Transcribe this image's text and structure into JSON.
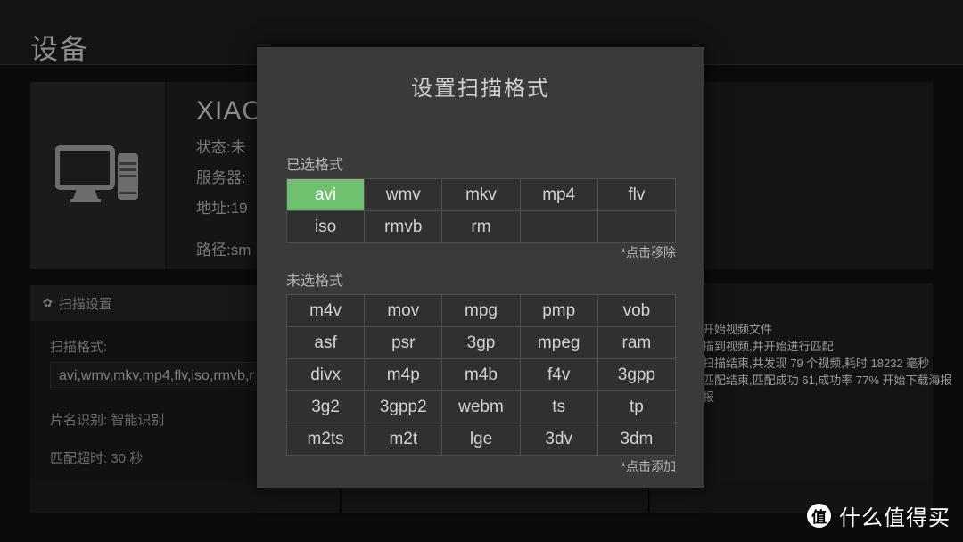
{
  "app": {
    "title": "设备"
  },
  "device": {
    "icon": "desktop-computer-icon",
    "name": "XIAO",
    "lines": [
      "状态:未",
      "服务器:",
      "地址:19",
      "路径:sm"
    ]
  },
  "scan_settings": {
    "gear_icon": "✿",
    "header": "扫描设置",
    "format_label": "扫描格式:",
    "format_value": "avi,wmv,mkv,mp4,flv,iso,rmvb,r",
    "title_recognition": "片名识别: 智能识别",
    "match_timeout": "匹配超时: 30 秒"
  },
  "log": {
    "lines": [
      "开始视频文件",
      "描到视频,并开始进行匹配",
      "扫描结束,共发现 79 个视频,耗时 18232 毫秒",
      "匹配结束,匹配成功 61,成功率 77% 开始下载海报",
      "报"
    ]
  },
  "modal": {
    "title": "设置扫描格式",
    "selected_label": "已选格式",
    "selected_hint": "*点击移除",
    "unselected_label": "未选格式",
    "unselected_hint": "*点击添加",
    "selected_formats": [
      {
        "label": "avi",
        "active": true
      },
      {
        "label": "wmv",
        "active": false
      },
      {
        "label": "mkv",
        "active": false
      },
      {
        "label": "mp4",
        "active": false
      },
      {
        "label": "flv",
        "active": false
      },
      {
        "label": "iso",
        "active": false
      },
      {
        "label": "rmvb",
        "active": false
      },
      {
        "label": "rm",
        "active": false
      },
      {
        "label": "",
        "active": false
      },
      {
        "label": "",
        "active": false
      }
    ],
    "unselected_formats": [
      {
        "label": "m4v"
      },
      {
        "label": "mov"
      },
      {
        "label": "mpg"
      },
      {
        "label": "pmp"
      },
      {
        "label": "vob"
      },
      {
        "label": "asf"
      },
      {
        "label": "psr"
      },
      {
        "label": "3gp"
      },
      {
        "label": "mpeg"
      },
      {
        "label": "ram"
      },
      {
        "label": "divx"
      },
      {
        "label": "m4p"
      },
      {
        "label": "m4b"
      },
      {
        "label": "f4v"
      },
      {
        "label": "3gpp"
      },
      {
        "label": "3g2"
      },
      {
        "label": "3gpp2"
      },
      {
        "label": "webm"
      },
      {
        "label": "ts"
      },
      {
        "label": "tp"
      },
      {
        "label": "m2ts"
      },
      {
        "label": "m2t"
      },
      {
        "label": "lge"
      },
      {
        "label": "3dv"
      },
      {
        "label": "3dm"
      }
    ],
    "accent_color": "#6fc16f"
  },
  "watermark": {
    "logo_char": "值",
    "text": "什么值得买"
  }
}
